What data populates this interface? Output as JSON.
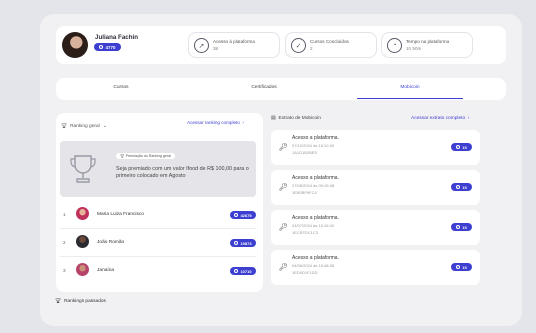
{
  "profile": {
    "name": "Juliana Fachin",
    "coins": "4770"
  },
  "stats": [
    {
      "icon": "compass-icon",
      "label": "Acesso à plataforma",
      "value": "38"
    },
    {
      "icon": "check-circle-icon",
      "label": "Cursos Concluídos",
      "value": "2"
    },
    {
      "icon": "clock-icon",
      "label": "Tempo na plataforma",
      "value": "1h 50m"
    }
  ],
  "tabs": [
    {
      "label": "Cursos"
    },
    {
      "label": "Certificados"
    },
    {
      "label": "Mobicoin"
    }
  ],
  "ranking": {
    "filter_label": "Ranking geral",
    "full_link": "Acessar ranking completo",
    "prize_tag": "Premiação do Ranking geral",
    "prize_text": "Seja premiado com um valor Ifood de R$ 100,00 para o primeiro colocado em Agosto",
    "entries": [
      {
        "pos": "1",
        "name": "Maria Luiza Francisco",
        "coins": "42675"
      },
      {
        "pos": "2",
        "name": "João Romão",
        "coins": "19873"
      },
      {
        "pos": "3",
        "name": "Janaína",
        "coins": "10710"
      }
    ],
    "past_label": "Rankings passados"
  },
  "extrato": {
    "title": "Extrato de Mobicoin",
    "link": "Acessar extrato completo",
    "items": [
      {
        "title": "Acesso a plataforma.",
        "date": "07/10/2024 às 15:10:30",
        "code": "1A1D1B2BE5",
        "coins": "15"
      },
      {
        "title": "Acesso a plataforma.",
        "date": "27/08/2024 às 09:15:48",
        "code": "1E8SBF9FC4",
        "coins": "15"
      },
      {
        "title": "Acesso a plataforma.",
        "date": "24/07/2024 às 10:16:42",
        "code": "1ECEFDC1C3",
        "coins": "15"
      },
      {
        "title": "Acesso a plataforma.",
        "date": "04/06/2024 às 15:48:38",
        "code": "1ED0D1F1DD",
        "coins": "15"
      }
    ]
  },
  "colors": {
    "accent": "#3c3fcf",
    "background": "#e4e5ea"
  }
}
